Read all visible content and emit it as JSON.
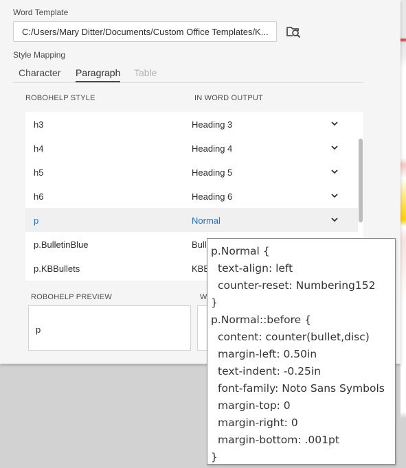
{
  "word_template": {
    "label": "Word Template",
    "path": "C:/Users/Mary Ditter/Documents/Custom Office Templates/K..."
  },
  "style_mapping": {
    "label": "Style Mapping",
    "tabs": [
      {
        "label": "Character",
        "state": "normal"
      },
      {
        "label": "Paragraph",
        "state": "active"
      },
      {
        "label": "Table",
        "state": "disabled"
      }
    ],
    "col_robohelp": "ROBOHELP STYLE",
    "col_word": "IN WORD OUTPUT",
    "rows": [
      {
        "style": "h3",
        "word": "Heading 3"
      },
      {
        "style": "h4",
        "word": "Heading 4"
      },
      {
        "style": "h5",
        "word": "Heading 5"
      },
      {
        "style": "h6",
        "word": "Heading 6"
      },
      {
        "style": "p",
        "word": "Normal"
      },
      {
        "style": "p.BulletinBlue",
        "word": "Bull"
      },
      {
        "style": "p.KBBullets",
        "word": "KBB"
      }
    ],
    "selected_row": "p"
  },
  "preview": {
    "robohelp_label": "ROBOHELP PREVIEW",
    "robohelp_text": "p",
    "word_label": "W"
  },
  "tooltip": {
    "lines": [
      {
        "text": "p.Normal {",
        "indent": false
      },
      {
        "text": "text-align: left",
        "indent": true
      },
      {
        "text": "counter-reset: Numbering152",
        "indent": true
      },
      {
        "text": "}",
        "indent": false
      },
      {
        "text": "p.Normal::before {",
        "indent": false
      },
      {
        "text": "content: counter(bullet,disc)",
        "indent": true
      },
      {
        "text": "margin-left: 0.50in",
        "indent": true
      },
      {
        "text": "text-indent: -0.25in",
        "indent": true
      },
      {
        "text": "font-family: Noto Sans Symbols",
        "indent": true
      },
      {
        "text": "margin-top: 0",
        "indent": true
      },
      {
        "text": "margin-right: 0",
        "indent": true
      },
      {
        "text": "margin-bottom: .001pt",
        "indent": true
      },
      {
        "text": "}",
        "indent": false
      }
    ]
  },
  "colors": {
    "accent": "#1473e6",
    "panel_bg": "#f5f5f5"
  }
}
